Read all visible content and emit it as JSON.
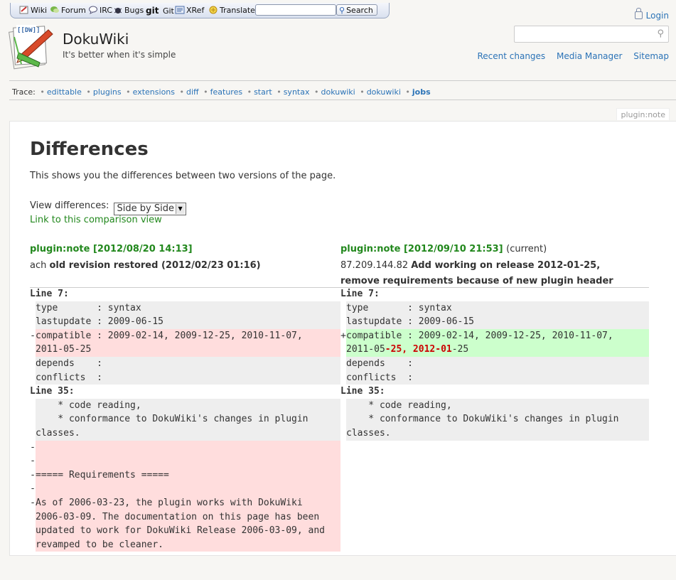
{
  "toolbar": {
    "items": [
      "Wiki",
      "Forum",
      "IRC",
      "Bugs",
      "Git",
      "XRef",
      "Translate"
    ],
    "git_word": "git",
    "search_label": "Search"
  },
  "header": {
    "title": "DokuWiki",
    "tagline": "It's better when it's simple",
    "login": "Login",
    "nav": [
      "Recent changes",
      "Media Manager",
      "Sitemap"
    ],
    "logo_text": "[[DW]]"
  },
  "trace": {
    "label": "Trace:",
    "items": [
      "edittable",
      "plugins",
      "extensions",
      "diff",
      "features",
      "start",
      "syntax",
      "dokuwiki",
      "dokuwiki"
    ],
    "current": "jobs"
  },
  "page_id": "plugin:note",
  "main": {
    "title": "Differences",
    "intro": "This shows you the differences between two versions of the page.",
    "view_label": "View differences:",
    "view_value": "Side by Side",
    "compare_link": "Link to this comparison view"
  },
  "revisions": {
    "left": {
      "title": "plugin:note [2012/08/20 14:13]",
      "author": "ach",
      "summary": "old revision restored (2012/02/23 01:16)"
    },
    "right": {
      "title": "plugin:note [2012/09/10 21:53]",
      "current": "(current)",
      "author": "87.209.144.82",
      "summary": "Add working on release 2012-01-25, remove requirements because of new plugin header"
    }
  },
  "diff": {
    "line7": "Line 7:",
    "line35": "Line 35:",
    "ctx_type": "type       : syntax",
    "ctx_lastupdate": "lastupdate : 2009-06-15",
    "del_compatible_1": "compatible : 2009-02-14, 2009-12-25, 2010-11-07,",
    "del_compatible_2": "2011-05-25",
    "add_compatible_1": "compatible : 2009-02-14, 2009-12-25, 2010-11-07,",
    "add_compatible_2a": "2011-05",
    "add_compatible_2b": "-25, 2012-01",
    "add_compatible_2c": "-25",
    "ctx_depends": "depends    :",
    "ctx_conflicts": "conflicts  :",
    "ctx_code": "    * code reading,",
    "ctx_conformance": "    * conformance to DokuWiki's changes in plugin",
    "ctx_classes": "classes.",
    "del_requirements": "===== Requirements =====",
    "del_asof_1": "As of 2006-03-23, the plugin works with DokuWiki",
    "del_asof_2": "2006-03-09. The documentation on this page has been",
    "del_asof_3": "updated to work for DokuWiki Release 2006-03-09, and",
    "del_asof_4": "revamped to be cleaner.",
    "minus": "-",
    "plus": "+"
  }
}
